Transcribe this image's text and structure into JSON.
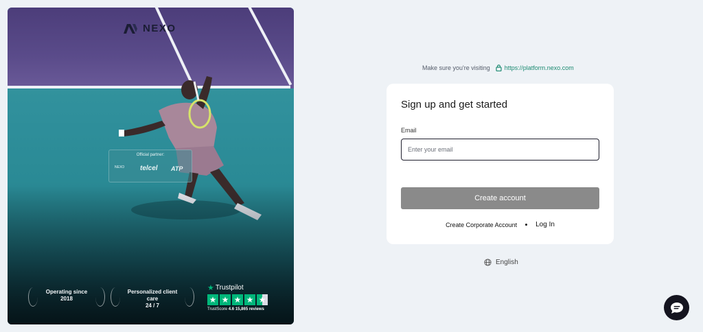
{
  "hero": {
    "brand": "NEXO",
    "partner": {
      "label": "Official partner:",
      "nexo": "NEXO",
      "telcel": "telcel",
      "atp": "ATP"
    },
    "badges": [
      {
        "line1": "Operating since",
        "line2": "2018"
      },
      {
        "line1": "Personalized client care",
        "line2": "24 / 7"
      }
    ],
    "trustpilot": {
      "name": "Trustpilot",
      "score_label": "TrustScore",
      "score": "4.6",
      "reviews": "15,865 reviews",
      "rating_stars": 4.5
    }
  },
  "visit": {
    "prompt": "Make sure you're visiting",
    "url": "https://platform.nexo.com"
  },
  "signup": {
    "title": "Sign up and get started",
    "email_label": "Email",
    "email_placeholder": "Enter your email",
    "email_value": "",
    "create_label": "Create account",
    "corporate_label": "Create Corporate Account",
    "login_label": "Log In"
  },
  "language": {
    "label": "English"
  },
  "icons": {
    "lock": "lock-icon",
    "globe": "globe-icon",
    "chat": "chat-icon",
    "trustpilot_star": "trustpilot-star-icon"
  },
  "colors": {
    "accent_green": "#1d8b72",
    "trustpilot_green": "#00b67a",
    "button_disabled": "#8a8a8a",
    "page_bg": "#eef2f6",
    "chat_bg": "#14141f"
  }
}
